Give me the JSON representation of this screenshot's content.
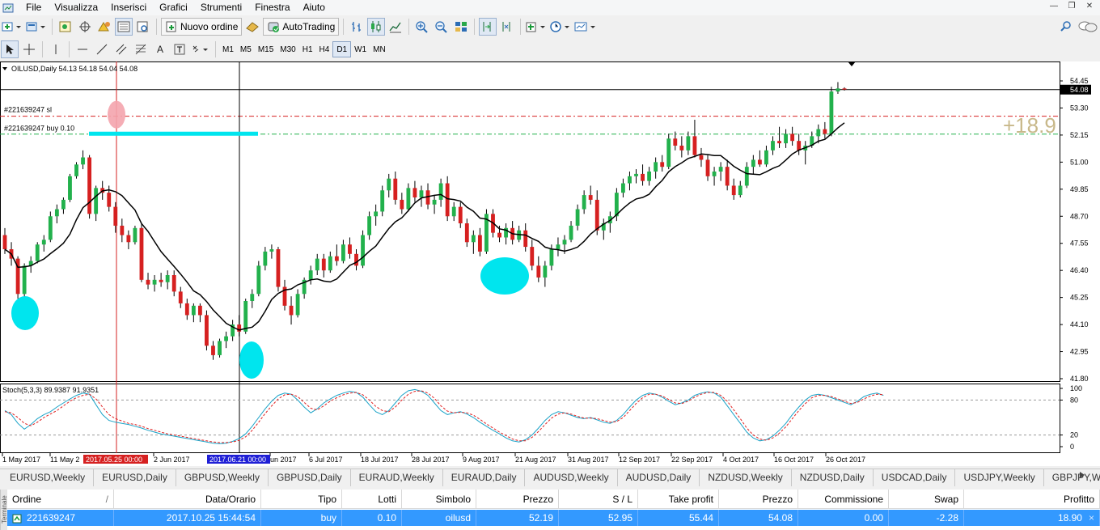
{
  "menu": {
    "items": [
      "File",
      "Visualizza",
      "Inserisci",
      "Grafici",
      "Strumenti",
      "Finestra",
      "Aiuto"
    ]
  },
  "toolbar": {
    "new_order_label": "Nuovo ordine",
    "autotrading_label": "AutoTrading",
    "timeframes": [
      "M1",
      "M5",
      "M15",
      "M30",
      "H1",
      "H4",
      "D1",
      "W1",
      "MN"
    ],
    "active_timeframe": "D1",
    "text_tool": "A"
  },
  "chart": {
    "symbol_info": "OILUSD,Daily  54.13 54.18 54.04 54.08",
    "sl_label": "#221639247 sl",
    "buy_label": "#221639247 buy 0.10",
    "profit_overlay": "+18.9",
    "current_price_label": "54.08",
    "stoch_label": "Stoch(5,3,3) 89.9387 91.9351",
    "price_axis": [
      "54.45",
      "53.30",
      "52.15",
      "51.00",
      "49.85",
      "48.70",
      "47.55",
      "46.40",
      "45.25",
      "44.10",
      "42.95",
      "41.80"
    ],
    "stoch_axis": [
      "100",
      "80",
      "20",
      "0"
    ],
    "date_labels": [
      "1 May 2017",
      "11 May 2",
      "2 Jun 2017",
      "un 2017",
      "6 Jul 2017",
      "18 Jul 2017",
      "28 Jul 2017",
      "9 Aug 2017",
      "21 Aug 2017",
      "31 Aug 2017",
      "12 Sep 2017",
      "22 Sep 2017",
      "4 Oct 2017",
      "16 Oct 2017",
      "26 Oct 2017"
    ],
    "cursor_date_1": "2017.05.25 00:00",
    "cursor_date_2": "2017.06.21 00:00",
    "colors": {
      "bull": "#22b14c",
      "bear": "#d62020",
      "ma": "#000000",
      "sl_line": "#d62020",
      "buy_line": "#22b14c",
      "highlight": "#00e5ee",
      "profit_text": "#c8b88a",
      "stoch_main": "#1aa3c8",
      "stoch_signal": "#e02020",
      "date_highlight_1": "#d62020",
      "date_highlight_2": "#1f1fd6"
    }
  },
  "chart_data": {
    "type": "candlestick",
    "symbol": "OILUSD",
    "timeframe": "Daily",
    "ylim": [
      41.8,
      55.0
    ],
    "candles": [
      [
        47.9,
        48.2,
        47.1,
        47.3
      ],
      [
        47.3,
        47.6,
        46.6,
        46.9
      ],
      [
        46.9,
        47.0,
        45.2,
        45.4
      ],
      [
        45.4,
        46.7,
        45.3,
        46.6
      ],
      [
        46.6,
        47.0,
        46.3,
        46.8
      ],
      [
        46.8,
        47.6,
        46.7,
        47.5
      ],
      [
        47.5,
        47.9,
        47.2,
        47.7
      ],
      [
        47.7,
        48.9,
        47.6,
        48.7
      ],
      [
        48.7,
        49.2,
        48.4,
        49.0
      ],
      [
        49.0,
        49.5,
        48.8,
        49.4
      ],
      [
        49.4,
        50.5,
        49.3,
        50.4
      ],
      [
        50.4,
        51.0,
        50.3,
        50.9
      ],
      [
        50.9,
        51.5,
        50.7,
        51.2
      ],
      [
        51.2,
        51.3,
        48.6,
        48.8
      ],
      [
        48.8,
        50.0,
        48.5,
        49.9
      ],
      [
        49.9,
        50.2,
        49.4,
        49.7
      ],
      [
        49.7,
        50.0,
        48.9,
        49.1
      ],
      [
        49.1,
        49.3,
        48.0,
        48.3
      ],
      [
        48.3,
        48.6,
        47.6,
        47.9
      ],
      [
        47.9,
        48.1,
        47.3,
        47.6
      ],
      [
        47.6,
        48.3,
        47.5,
        48.2
      ],
      [
        48.2,
        48.4,
        45.9,
        46.0
      ],
      [
        46.0,
        46.3,
        45.6,
        45.8
      ],
      [
        45.8,
        46.2,
        45.5,
        46.0
      ],
      [
        46.0,
        46.3,
        45.7,
        45.9
      ],
      [
        45.9,
        46.4,
        45.6,
        46.2
      ],
      [
        46.2,
        46.4,
        45.3,
        45.5
      ],
      [
        45.5,
        45.7,
        44.8,
        45.0
      ],
      [
        45.0,
        45.2,
        44.3,
        44.5
      ],
      [
        44.5,
        45.0,
        44.2,
        44.9
      ],
      [
        44.9,
        45.0,
        44.2,
        44.5
      ],
      [
        44.5,
        44.7,
        43.0,
        43.2
      ],
      [
        43.2,
        43.4,
        42.6,
        42.8
      ],
      [
        42.8,
        43.5,
        42.7,
        43.4
      ],
      [
        43.4,
        43.8,
        43.1,
        43.6
      ],
      [
        43.6,
        44.3,
        43.4,
        44.1
      ],
      [
        44.1,
        44.5,
        43.6,
        43.8
      ],
      [
        43.8,
        45.2,
        43.7,
        45.1
      ],
      [
        45.1,
        45.6,
        44.8,
        45.4
      ],
      [
        45.4,
        46.8,
        45.3,
        46.6
      ],
      [
        46.6,
        47.4,
        46.4,
        47.2
      ],
      [
        47.2,
        47.5,
        46.9,
        47.3
      ],
      [
        47.3,
        47.4,
        45.5,
        45.7
      ],
      [
        45.7,
        46.0,
        44.7,
        44.9
      ],
      [
        44.9,
        45.3,
        44.1,
        44.5
      ],
      [
        44.5,
        45.6,
        44.4,
        45.4
      ],
      [
        45.4,
        46.1,
        45.2,
        46.0
      ],
      [
        46.0,
        46.6,
        45.8,
        46.4
      ],
      [
        46.4,
        47.1,
        46.2,
        46.9
      ],
      [
        46.9,
        47.1,
        46.1,
        46.4
      ],
      [
        46.4,
        47.2,
        46.3,
        47.0
      ],
      [
        47.0,
        47.5,
        46.6,
        46.8
      ],
      [
        46.8,
        47.7,
        46.7,
        47.5
      ],
      [
        47.5,
        47.8,
        46.9,
        47.1
      ],
      [
        47.1,
        47.3,
        46.4,
        46.6
      ],
      [
        46.6,
        48.1,
        46.5,
        47.9
      ],
      [
        47.9,
        48.9,
        47.7,
        48.7
      ],
      [
        48.7,
        49.2,
        48.3,
        48.9
      ],
      [
        48.9,
        50.0,
        48.7,
        49.8
      ],
      [
        49.8,
        50.5,
        49.5,
        50.3
      ],
      [
        50.3,
        50.6,
        49.2,
        49.4
      ],
      [
        49.4,
        49.7,
        48.8,
        49.0
      ],
      [
        49.0,
        50.1,
        48.9,
        49.9
      ],
      [
        49.9,
        50.2,
        49.3,
        49.5
      ],
      [
        49.5,
        50.0,
        49.1,
        49.8
      ],
      [
        49.8,
        50.1,
        49.0,
        49.2
      ],
      [
        49.2,
        49.6,
        48.8,
        49.4
      ],
      [
        49.4,
        50.3,
        49.1,
        50.1
      ],
      [
        50.1,
        50.4,
        48.5,
        48.7
      ],
      [
        48.7,
        49.3,
        48.5,
        49.1
      ],
      [
        49.1,
        49.3,
        48.2,
        48.4
      ],
      [
        48.4,
        48.6,
        47.4,
        47.6
      ],
      [
        47.6,
        48.1,
        47.1,
        47.9
      ],
      [
        47.9,
        48.2,
        47.0,
        47.2
      ],
      [
        47.2,
        49.0,
        47.1,
        48.8
      ],
      [
        48.8,
        49.0,
        47.8,
        48.0
      ],
      [
        48.0,
        48.3,
        47.6,
        47.8
      ],
      [
        47.8,
        48.4,
        47.5,
        48.2
      ],
      [
        48.2,
        48.5,
        47.5,
        47.7
      ],
      [
        47.7,
        48.3,
        47.6,
        48.1
      ],
      [
        48.1,
        48.4,
        47.2,
        47.4
      ],
      [
        47.4,
        47.7,
        46.4,
        46.6
      ],
      [
        46.6,
        47.0,
        45.9,
        46.1
      ],
      [
        46.1,
        46.8,
        45.7,
        46.6
      ],
      [
        46.6,
        47.5,
        46.4,
        47.3
      ],
      [
        47.3,
        47.8,
        47.0,
        47.5
      ],
      [
        47.5,
        47.9,
        47.1,
        47.7
      ],
      [
        47.7,
        48.5,
        47.6,
        48.3
      ],
      [
        48.3,
        49.2,
        48.1,
        49.0
      ],
      [
        49.0,
        49.8,
        48.8,
        49.6
      ],
      [
        49.6,
        50.0,
        49.2,
        49.4
      ],
      [
        49.4,
        49.8,
        47.9,
        48.1
      ],
      [
        48.1,
        48.6,
        47.7,
        48.4
      ],
      [
        48.4,
        48.9,
        48.0,
        48.7
      ],
      [
        48.7,
        49.9,
        48.5,
        49.7
      ],
      [
        49.7,
        50.3,
        49.5,
        50.1
      ],
      [
        50.1,
        50.6,
        49.8,
        50.4
      ],
      [
        50.4,
        50.7,
        50.1,
        50.5
      ],
      [
        50.5,
        50.9,
        50.0,
        50.2
      ],
      [
        50.2,
        50.8,
        50.0,
        50.6
      ],
      [
        50.6,
        51.2,
        50.3,
        51.0
      ],
      [
        51.0,
        51.3,
        50.6,
        50.8
      ],
      [
        50.8,
        52.2,
        50.7,
        52.0
      ],
      [
        52.0,
        52.3,
        51.5,
        51.7
      ],
      [
        51.7,
        52.1,
        51.2,
        51.5
      ],
      [
        51.5,
        52.3,
        51.3,
        52.1
      ],
      [
        52.1,
        52.8,
        51.2,
        51.3
      ],
      [
        51.3,
        51.6,
        50.8,
        51.1
      ],
      [
        51.1,
        51.3,
        50.2,
        50.4
      ],
      [
        50.4,
        50.8,
        50.0,
        50.6
      ],
      [
        50.6,
        51.0,
        50.2,
        50.8
      ],
      [
        50.8,
        51.1,
        49.8,
        50.0
      ],
      [
        50.0,
        50.3,
        49.4,
        49.6
      ],
      [
        49.6,
        50.2,
        49.5,
        50.0
      ],
      [
        50.0,
        51.0,
        49.9,
        50.8
      ],
      [
        50.8,
        51.3,
        50.5,
        51.1
      ],
      [
        51.1,
        51.5,
        50.8,
        50.9
      ],
      [
        50.9,
        51.7,
        50.8,
        51.5
      ],
      [
        51.5,
        52.1,
        51.3,
        51.9
      ],
      [
        51.9,
        52.5,
        51.6,
        51.8
      ],
      [
        51.8,
        52.4,
        51.6,
        52.2
      ],
      [
        52.2,
        52.5,
        51.7,
        51.9
      ],
      [
        51.9,
        52.2,
        51.3,
        51.5
      ],
      [
        51.5,
        51.9,
        50.9,
        51.7
      ],
      [
        51.7,
        52.3,
        51.6,
        52.1
      ],
      [
        52.1,
        52.6,
        51.8,
        52.4
      ],
      [
        52.4,
        52.7,
        52.0,
        52.2
      ],
      [
        52.2,
        54.2,
        52.1,
        54.0
      ],
      [
        54.0,
        54.4,
        53.9,
        54.13
      ],
      [
        54.13,
        54.18,
        54.04,
        54.08
      ]
    ],
    "stochastic": {
      "main": [
        62,
        55,
        40,
        30,
        38,
        48,
        55,
        60,
        68,
        75,
        82,
        88,
        92,
        90,
        72,
        55,
        45,
        42,
        40,
        38,
        35,
        32,
        28,
        25,
        22,
        20,
        18,
        16,
        14,
        12,
        10,
        8,
        6,
        5,
        6,
        9,
        14,
        22,
        35,
        50,
        65,
        78,
        88,
        92,
        90,
        80,
        68,
        58,
        65,
        75,
        82,
        88,
        92,
        95,
        93,
        85,
        72,
        60,
        55,
        62,
        75,
        88,
        96,
        98,
        95,
        88,
        75,
        62,
        55,
        58,
        60,
        56,
        50,
        42,
        35,
        28,
        22,
        15,
        10,
        8,
        12,
        20,
        32,
        45,
        55,
        60,
        58,
        54,
        50,
        48,
        50,
        46,
        42,
        40,
        45,
        55,
        68,
        80,
        88,
        92,
        90,
        85,
        78,
        72,
        75,
        80,
        88,
        92,
        94,
        92,
        85,
        70,
        55,
        40,
        25,
        15,
        10,
        12,
        18,
        28,
        40,
        55,
        68,
        80,
        88,
        90,
        88,
        84,
        80,
        76,
        72,
        78,
        86,
        90,
        92,
        88
      ],
      "signal": [
        60,
        58,
        50,
        40,
        36,
        42,
        50,
        56,
        62,
        70,
        78,
        84,
        88,
        90,
        82,
        68,
        55,
        48,
        44,
        40,
        38,
        35,
        31,
        28,
        25,
        22,
        20,
        18,
        16,
        14,
        12,
        10,
        8,
        7,
        7,
        8,
        11,
        17,
        28,
        42,
        57,
        70,
        82,
        89,
        90,
        86,
        76,
        66,
        63,
        70,
        78,
        84,
        89,
        92,
        93,
        89,
        80,
        69,
        62,
        60,
        68,
        80,
        90,
        95,
        96,
        92,
        83,
        70,
        61,
        58,
        59,
        58,
        54,
        47,
        39,
        32,
        25,
        19,
        13,
        10,
        10,
        16,
        26,
        38,
        49,
        56,
        58,
        56,
        52,
        49,
        49,
        48,
        45,
        42,
        43,
        50,
        62,
        74,
        84,
        90,
        90,
        87,
        81,
        75,
        74,
        78,
        85,
        90,
        93,
        93,
        88,
        78,
        63,
        48,
        32,
        20,
        13,
        11,
        15,
        23,
        34,
        48,
        62,
        74,
        84,
        88,
        88,
        86,
        82,
        78,
        74,
        76,
        82,
        87,
        90,
        89
      ]
    },
    "annotations": {
      "sl_price": 52.95,
      "buy_price": 52.19,
      "current_price": 54.08,
      "profit": "+18.9"
    }
  },
  "symbol_tabs": [
    "EURUSD,Weekly",
    "EURUSD,Daily",
    "GBPUSD,Weekly",
    "GBPUSD,Daily",
    "EURAUD,Weekly",
    "EURAUD,Daily",
    "AUDUSD,Weekly",
    "AUDUSD,Daily",
    "NZDUSD,Weekly",
    "NZDUSD,Daily",
    "USDCAD,Daily",
    "USDJPY,Weekly",
    "GBPJPY,Weekly"
  ],
  "terminal": {
    "side_label": "Terminale",
    "headers": [
      "Ordine",
      "/",
      "Data/Orario",
      "Tipo",
      "Lotti",
      "Simbolo",
      "Prezzo",
      "S / L",
      "Take profit",
      "Prezzo",
      "Commissione",
      "Swap",
      "Profitto"
    ],
    "row": [
      "221639247",
      "2017.10.25 15:44:54",
      "buy",
      "0.10",
      "oilusd",
      "52.19",
      "52.95",
      "55.44",
      "54.08",
      "0.00",
      "-2.28",
      "18.90"
    ],
    "close_glyph": "×"
  }
}
